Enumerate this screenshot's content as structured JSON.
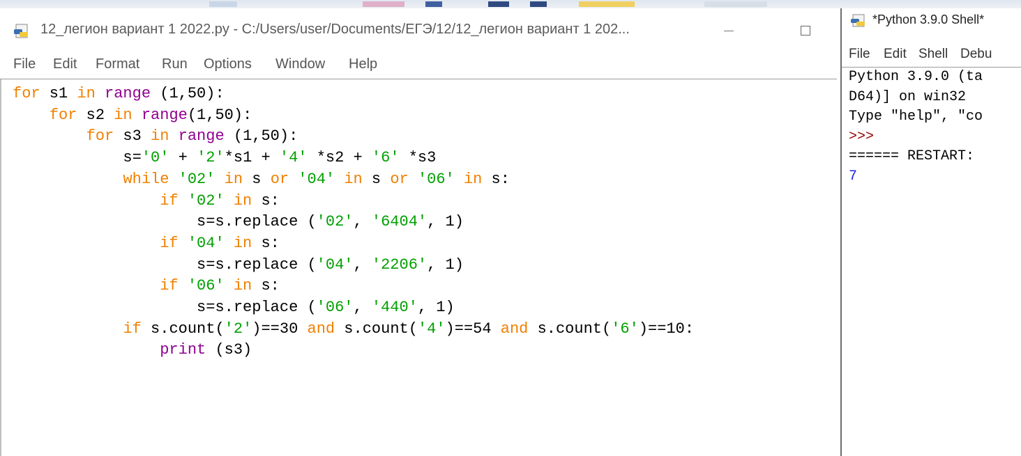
{
  "colors": {
    "keyword": "#f08000",
    "builtin": "#900090",
    "string": "#00a000",
    "prompt": "#900000",
    "output": "#2020e0"
  },
  "editor": {
    "title": "12_легион вариант 1 2022.py - C:/Users/user/Documents/ЕГЭ/12/12_легион вариант 1 202...",
    "icon": "python-file-icon",
    "menu": [
      "File",
      "Edit",
      "Format",
      "Run",
      "Options",
      "Window",
      "Help"
    ],
    "code": [
      [
        {
          "t": "for",
          "c": "kw"
        },
        {
          "t": " s1 "
        },
        {
          "t": "in",
          "c": "kw"
        },
        {
          "t": " "
        },
        {
          "t": "range",
          "c": "bi"
        },
        {
          "t": " (1,50):"
        }
      ],
      [
        {
          "t": "    "
        },
        {
          "t": "for",
          "c": "kw"
        },
        {
          "t": " s2 "
        },
        {
          "t": "in",
          "c": "kw"
        },
        {
          "t": " "
        },
        {
          "t": "range",
          "c": "bi"
        },
        {
          "t": "(1,50):"
        }
      ],
      [
        {
          "t": "        "
        },
        {
          "t": "for",
          "c": "kw"
        },
        {
          "t": " s3 "
        },
        {
          "t": "in",
          "c": "kw"
        },
        {
          "t": " "
        },
        {
          "t": "range",
          "c": "bi"
        },
        {
          "t": " (1,50):"
        }
      ],
      [
        {
          "t": "            s="
        },
        {
          "t": "'0'",
          "c": "st"
        },
        {
          "t": " + "
        },
        {
          "t": "'2'",
          "c": "st"
        },
        {
          "t": "*s1 + "
        },
        {
          "t": "'4'",
          "c": "st"
        },
        {
          "t": " *s2 + "
        },
        {
          "t": "'6'",
          "c": "st"
        },
        {
          "t": " *s3"
        }
      ],
      [
        {
          "t": "            "
        },
        {
          "t": "while",
          "c": "kw"
        },
        {
          "t": " "
        },
        {
          "t": "'02'",
          "c": "st"
        },
        {
          "t": " "
        },
        {
          "t": "in",
          "c": "kw"
        },
        {
          "t": " s "
        },
        {
          "t": "or",
          "c": "kw"
        },
        {
          "t": " "
        },
        {
          "t": "'04'",
          "c": "st"
        },
        {
          "t": " "
        },
        {
          "t": "in",
          "c": "kw"
        },
        {
          "t": " s "
        },
        {
          "t": "or",
          "c": "kw"
        },
        {
          "t": " "
        },
        {
          "t": "'06'",
          "c": "st"
        },
        {
          "t": " "
        },
        {
          "t": "in",
          "c": "kw"
        },
        {
          "t": " s:"
        }
      ],
      [
        {
          "t": "                "
        },
        {
          "t": "if",
          "c": "kw"
        },
        {
          "t": " "
        },
        {
          "t": "'02'",
          "c": "st"
        },
        {
          "t": " "
        },
        {
          "t": "in",
          "c": "kw"
        },
        {
          "t": " s:"
        }
      ],
      [
        {
          "t": "                    s=s.replace ("
        },
        {
          "t": "'02'",
          "c": "st"
        },
        {
          "t": ", "
        },
        {
          "t": "'6404'",
          "c": "st"
        },
        {
          "t": ", 1)"
        }
      ],
      [
        {
          "t": "                "
        },
        {
          "t": "if",
          "c": "kw"
        },
        {
          "t": " "
        },
        {
          "t": "'04'",
          "c": "st"
        },
        {
          "t": " "
        },
        {
          "t": "in",
          "c": "kw"
        },
        {
          "t": " s:"
        }
      ],
      [
        {
          "t": "                    s=s.replace ("
        },
        {
          "t": "'04'",
          "c": "st"
        },
        {
          "t": ", "
        },
        {
          "t": "'2206'",
          "c": "st"
        },
        {
          "t": ", 1)"
        }
      ],
      [
        {
          "t": "                "
        },
        {
          "t": "if",
          "c": "kw"
        },
        {
          "t": " "
        },
        {
          "t": "'06'",
          "c": "st"
        },
        {
          "t": " "
        },
        {
          "t": "in",
          "c": "kw"
        },
        {
          "t": " s:"
        }
      ],
      [
        {
          "t": "                    s=s.replace ("
        },
        {
          "t": "'06'",
          "c": "st"
        },
        {
          "t": ", "
        },
        {
          "t": "'440'",
          "c": "st"
        },
        {
          "t": ", 1)"
        }
      ],
      [
        {
          "t": "            "
        },
        {
          "t": "if",
          "c": "kw"
        },
        {
          "t": " s.count("
        },
        {
          "t": "'2'",
          "c": "st"
        },
        {
          "t": ")==30 "
        },
        {
          "t": "and",
          "c": "kw"
        },
        {
          "t": " s.count("
        },
        {
          "t": "'4'",
          "c": "st"
        },
        {
          "t": ")==54 "
        },
        {
          "t": "and",
          "c": "kw"
        },
        {
          "t": " s.count("
        },
        {
          "t": "'6'",
          "c": "st"
        },
        {
          "t": ")==10:"
        }
      ],
      [
        {
          "t": "                "
        },
        {
          "t": "print",
          "c": "bi"
        },
        {
          "t": " (s3)"
        }
      ]
    ]
  },
  "shell": {
    "title": "*Python 3.9.0 Shell*",
    "icon": "python-shell-icon",
    "menu": [
      "File",
      "Edit",
      "Shell",
      "Debu"
    ],
    "lines": [
      {
        "t": "Python 3.9.0 (ta"
      },
      {
        "t": "D64)] on win32"
      },
      {
        "t": "Type \"help\", \"co"
      },
      {
        "t": ">>>",
        "c": "prompt"
      },
      {
        "t": "====== RESTART: "
      },
      {
        "t": "7",
        "c": "out"
      }
    ]
  }
}
